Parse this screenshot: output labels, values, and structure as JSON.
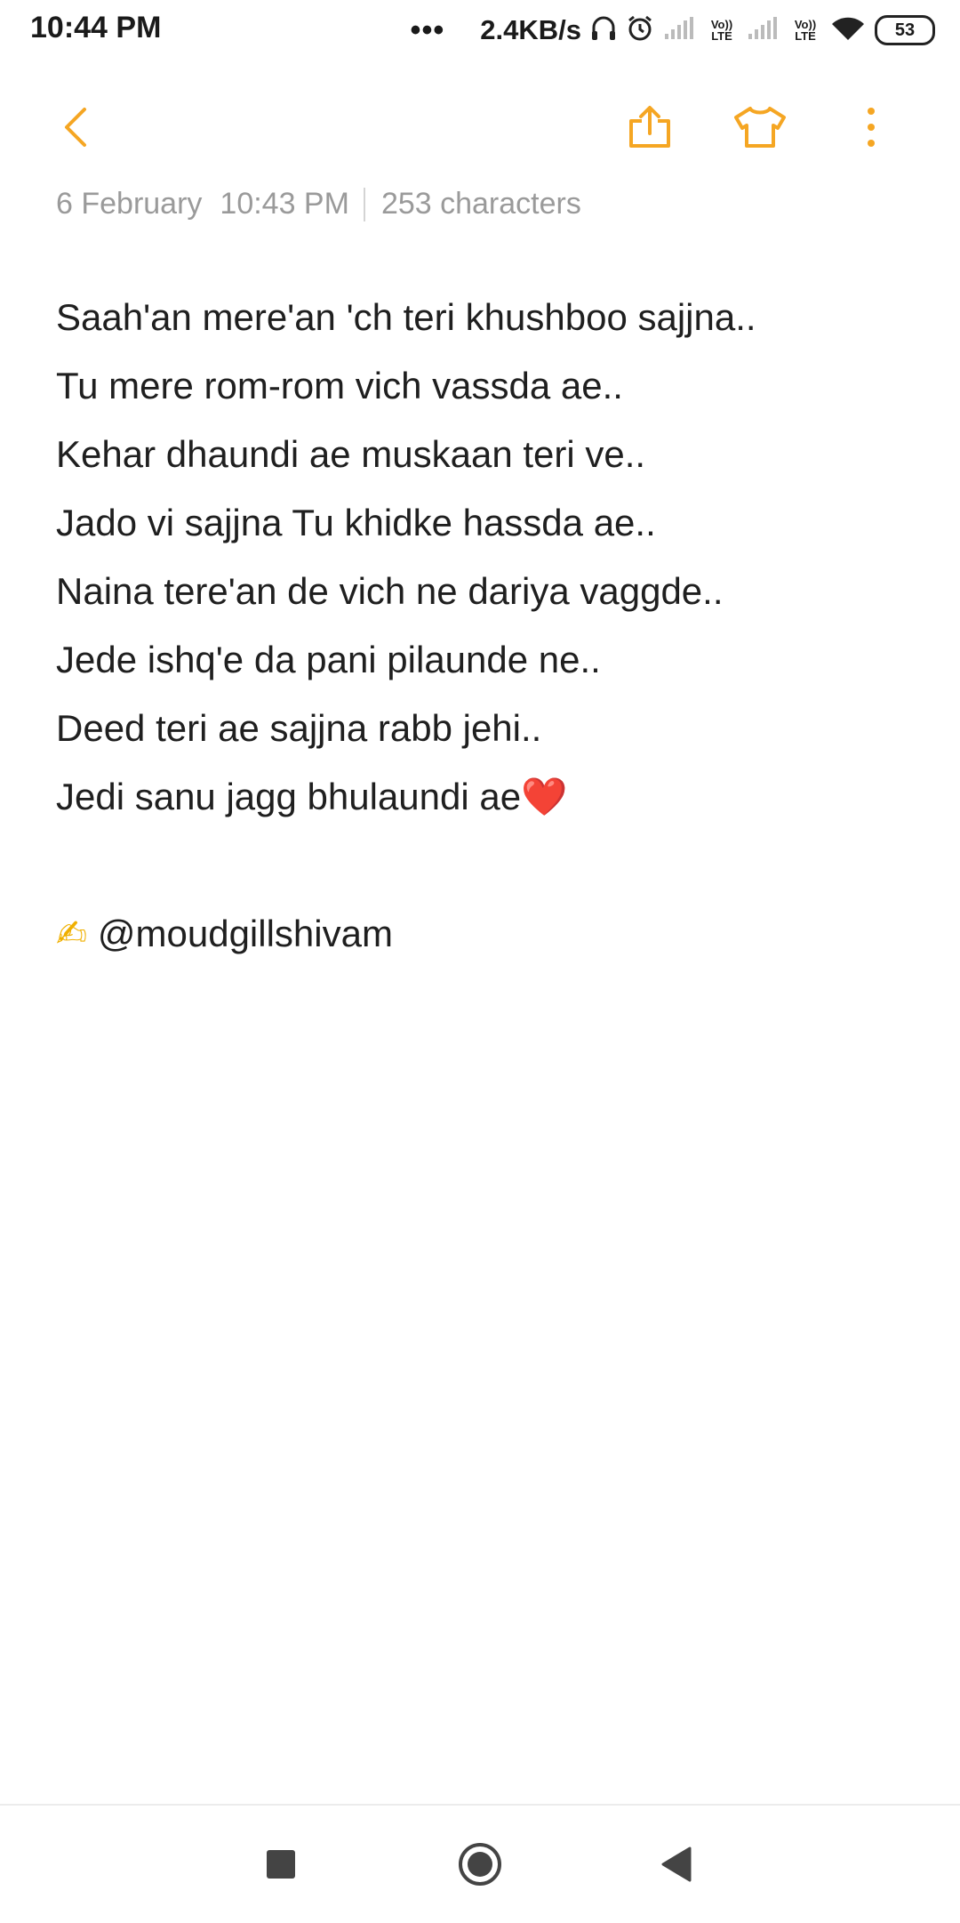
{
  "status_bar": {
    "time": "10:44 PM",
    "more_dots": "•••",
    "net_speed": "2.4KB/s",
    "volte_1": "Vo)) LTE",
    "volte_2": "Vo)) LTE",
    "battery": "53",
    "icons": [
      "headphones-icon",
      "alarm-icon",
      "signal-icon",
      "volte-icon",
      "signal-icon",
      "volte-icon",
      "wifi-icon",
      "battery-icon"
    ]
  },
  "toolbar": {
    "icons": [
      "back-chevron-icon",
      "share-icon",
      "theme-shirt-icon",
      "more-vertical-icon"
    ],
    "accent_color": "#F5A623"
  },
  "meta": {
    "date": "6 February",
    "time": "10:43 PM",
    "char_count": "253 characters"
  },
  "note": {
    "lines": [
      "Saah'an mere'an 'ch teri khushboo sajjna..",
      "Tu mere rom-rom vich vassda ae..",
      "Kehar dhaundi ae muskaan teri ve..",
      "Jado vi sajjna Tu khidke hassda ae..",
      "Naina tere'an de vich ne dariya vaggde..",
      "Jede ishq'e da pani pilaunde ne..",
      "Deed teri ae sajjna rabb jehi..",
      "Jedi sanu jagg bhulaundi ae"
    ],
    "heart_emoji": "❤️",
    "signature_emoji": "✍",
    "signature_handle": "@moudgillshivam"
  },
  "navbar": {
    "icons": [
      "recents-square-icon",
      "home-circle-icon",
      "back-triangle-icon"
    ]
  }
}
